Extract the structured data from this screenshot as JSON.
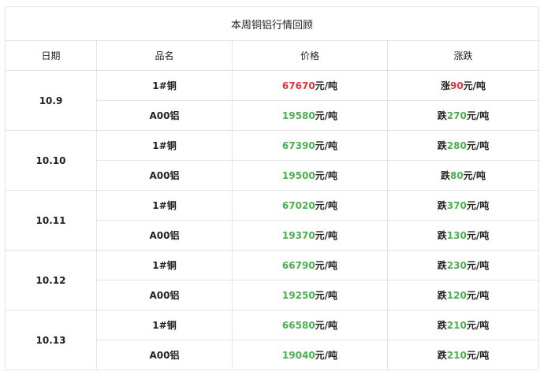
{
  "title": "本周铜铝行情回顾",
  "headers": [
    "日期",
    "品名",
    "价格",
    "涨跌"
  ],
  "colors": {
    "up": "#d9363e",
    "down": "#4caf50",
    "border": "#e3e3e3"
  },
  "rows": [
    {
      "date": "10.9",
      "items": [
        {
          "name": "1#铜",
          "price": "67670",
          "price_unit": "元/吨",
          "price_dir": "up",
          "change_word": "涨",
          "change": "90",
          "change_unit": "元/吨",
          "change_dir": "up"
        },
        {
          "name": "A00铝",
          "price": "19580",
          "price_unit": "元/吨",
          "price_dir": "down",
          "change_word": "跌",
          "change": "270",
          "change_unit": "元/吨",
          "change_dir": "down"
        }
      ]
    },
    {
      "date": "10.10",
      "items": [
        {
          "name": "1#铜",
          "price": "67390",
          "price_unit": "元/吨",
          "price_dir": "down",
          "change_word": "跌",
          "change": "280",
          "change_unit": "元/吨",
          "change_dir": "down"
        },
        {
          "name": "A00铝",
          "price": "19500",
          "price_unit": "元/吨",
          "price_dir": "down",
          "change_word": "跌",
          "change": "80",
          "change_unit": "元/吨",
          "change_dir": "down"
        }
      ]
    },
    {
      "date": "10.11",
      "items": [
        {
          "name": "1#铜",
          "price": "67020",
          "price_unit": "元/吨",
          "price_dir": "down",
          "change_word": "跌",
          "change": "370",
          "change_unit": "元/吨",
          "change_dir": "down"
        },
        {
          "name": "A00铝",
          "price": "19370",
          "price_unit": "元/吨",
          "price_dir": "down",
          "change_word": "跌",
          "change": "130",
          "change_unit": "元/吨",
          "change_dir": "down"
        }
      ]
    },
    {
      "date": "10.12",
      "items": [
        {
          "name": "1#铜",
          "price": "66790",
          "price_unit": "元/吨",
          "price_dir": "down",
          "change_word": "跌",
          "change": "230",
          "change_unit": "元/吨",
          "change_dir": "down"
        },
        {
          "name": "A00铝",
          "price": "19250",
          "price_unit": "元/吨",
          "price_dir": "down",
          "change_word": "跌",
          "change": "120",
          "change_unit": "元/吨",
          "change_dir": "down"
        }
      ]
    },
    {
      "date": "10.13",
      "items": [
        {
          "name": "1#铜",
          "price": "66580",
          "price_unit": "元/吨",
          "price_dir": "down",
          "change_word": "跌",
          "change": "210",
          "change_unit": "元/吨",
          "change_dir": "down"
        },
        {
          "name": "A00铝",
          "price": "19040",
          "price_unit": "元/吨",
          "price_dir": "down",
          "change_word": "跌",
          "change": "210",
          "change_unit": "元/吨",
          "change_dir": "down"
        }
      ]
    }
  ]
}
